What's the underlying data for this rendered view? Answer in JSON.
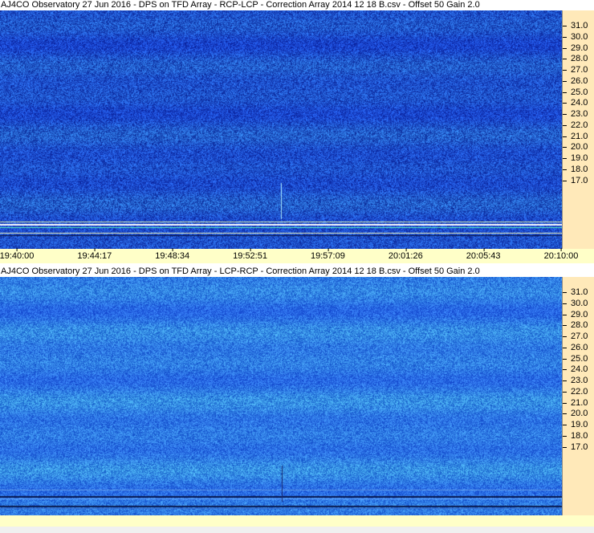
{
  "panels": [
    {
      "title": "AJ4CO Observatory 27 Jun 2016  -  DPS on TFD Array  -  RCP-LCP  -  Correction Array 2014 12 18 B.csv  -  Offset 50  Gain 2.0",
      "palette": "dark-blue",
      "y_ticks": [
        "31.0",
        "30.0",
        "29.0",
        "28.0",
        "27.0",
        "26.0",
        "25.0",
        "24.0",
        "23.0",
        "22.0",
        "21.0",
        "20.0",
        "19.0",
        "18.0",
        "17.0"
      ],
      "x_ticks": [
        "19:40:00",
        "19:44:17",
        "19:48:34",
        "19:52:51",
        "19:57:09",
        "20:01:26",
        "20:05:43",
        "20:10:00"
      ]
    },
    {
      "title": "AJ4CO Observatory 27 Jun 2016  -  DPS on TFD Array  -  LCP-RCP  -  Correction Array 2014 12 18 B.csv  -  Offset 50  Gain 2.0",
      "palette": "light-blue",
      "y_ticks": [
        "31.0",
        "30.0",
        "29.0",
        "28.0",
        "27.0",
        "26.0",
        "25.0",
        "24.0",
        "23.0",
        "22.0",
        "21.0",
        "20.0",
        "19.0",
        "18.0",
        "17.0"
      ]
    }
  ],
  "colors": {
    "axis_bg": "#ffe9b9",
    "time_bar_bg": "#ffffc8"
  }
}
